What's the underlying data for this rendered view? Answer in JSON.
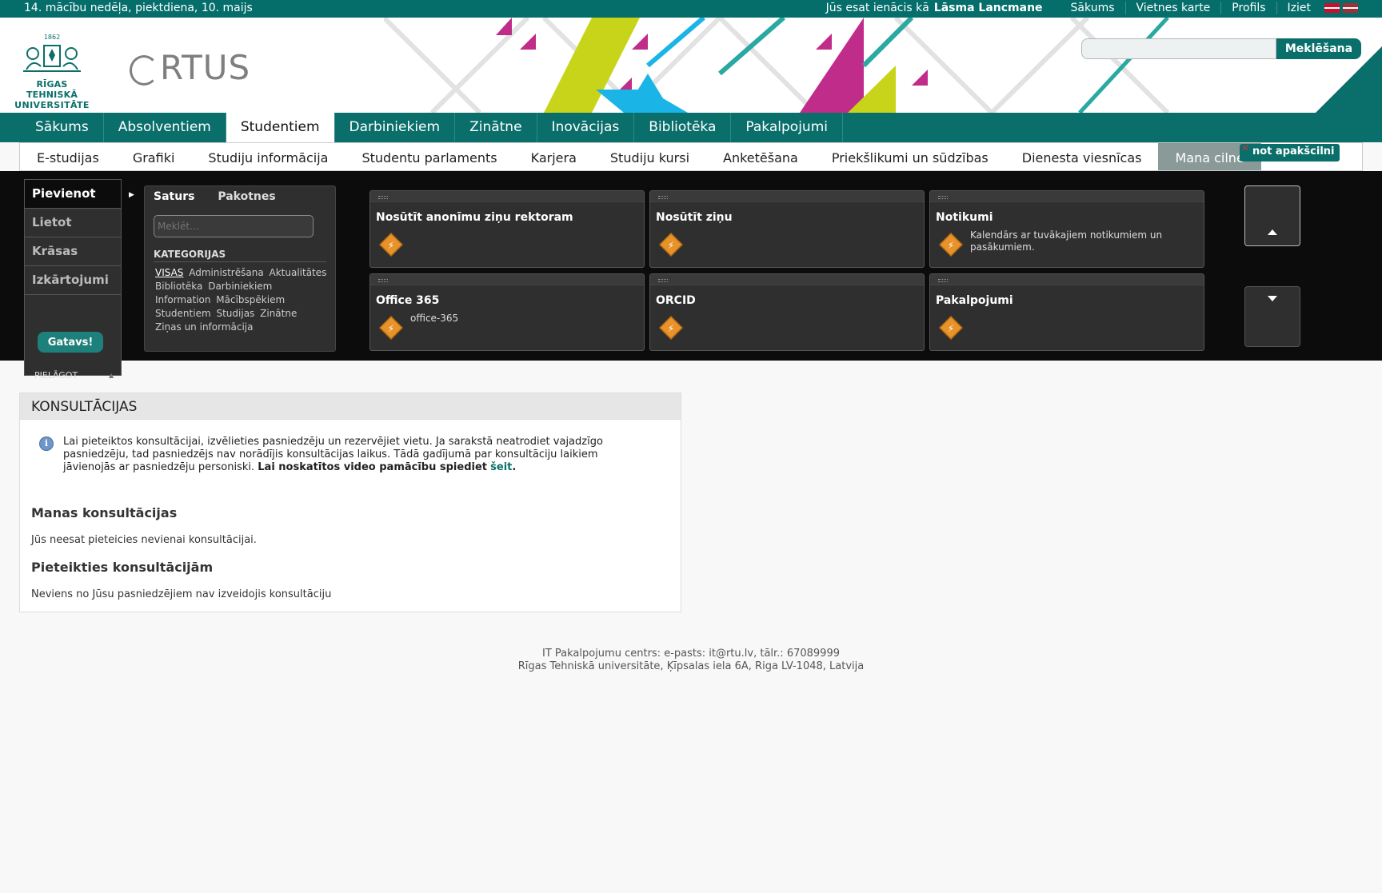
{
  "topbar": {
    "week": "14. mācību nedēļa, piektdiena, 10. maijs",
    "logged_in_as": "Jūs esat ienācis kā",
    "user_name": "Lāsma Lancmane",
    "links": [
      "Sākums",
      "Vietnes karte",
      "Profils",
      "Iziet"
    ]
  },
  "header": {
    "logo_year": "1862",
    "logo_line1": "RĪGAS TEHNISKĀ",
    "logo_line2": "UNIVERSITĀTE",
    "ortus": "RTUS",
    "search_button": "Meklēšana",
    "search_value": ""
  },
  "mainnav": [
    "Sākums",
    "Absolventiem",
    "Studentiem",
    "Darbiniekiem",
    "Zinātne",
    "Inovācijas",
    "Bibliotēka",
    "Pakalpojumi"
  ],
  "subnav": [
    "E-studijas",
    "Grafiki",
    "Studiju informācija",
    "Studentu parlaments",
    "Karjera",
    "Studiju kursi",
    "Anketēšana",
    "Priekšlikumi un sūdzības",
    "Dienesta viesnīcas",
    "Mana cilne"
  ],
  "pin_button": "not apakšcilni",
  "customize": {
    "menu": [
      "Pievienot",
      "Lietot",
      "Krāsas",
      "Izkārtojumi"
    ],
    "done_button": "Gatavs!",
    "pielagot": "PIELĀGOT",
    "tabs": [
      "Saturs",
      "Pakotnes"
    ],
    "search_placeholder": "Meklēt...",
    "categories_title": "KATEGORIJAS",
    "categories": [
      "VISAS",
      "Administrēšana",
      "Aktualitātes",
      "Bibliotēka",
      "Darbiniekiem",
      "Information",
      "Mācībspēkiem",
      "Studentiem",
      "Studijas",
      "Zinātne",
      "Ziņas un informācija"
    ],
    "tiles": [
      {
        "title": "Nosūtīt anonīmu ziņu rektoram",
        "desc": ""
      },
      {
        "title": "Nosūtīt ziņu",
        "desc": ""
      },
      {
        "title": "Notikumi",
        "desc": "Kalendārs ar tuvākajiem notikumiem un pasākumiem."
      },
      {
        "title": "Office 365",
        "desc": "office-365"
      },
      {
        "title": "ORCID",
        "desc": ""
      },
      {
        "title": "Pakalpojumi",
        "desc": ""
      }
    ]
  },
  "panel": {
    "title": "KONSULTĀCIJAS",
    "info_text": "Lai pieteiktos konsultācijai, izvēlieties pasniedzēju un rezervējiet vietu. Ja sarakstā neatrodiet vajadzīgo pasniedzēju, tad pasniedzējs nav norādījis konsultācijas laikus. Tādā gadījumā par konsultāciju laikiem jāvienojās ar pasniedzēju personiski.",
    "info_bold": "Lai noskatītos video pamācību spiediet",
    "info_link": "šeit",
    "my_title": "Manas konsultācijas",
    "my_text": "Jūs neesat pieteicies nevienai konsultācijai.",
    "apply_title": "Pieteikties konsultācijām",
    "apply_text": "Neviens no Jūsu pasniedzējiem nav izveidojis konsultāciju"
  },
  "footer": {
    "line1": "IT Pakalpojumu centrs: e-pasts: it@rtu.lv, tālr.: 67089999",
    "line2": "Rīgas Tehniskā universitāte, Ķīpsalas iela 6A, Riga LV-1048, Latvija"
  },
  "colors": {
    "brand": "#0a6f6b",
    "topbar": "#056e6b",
    "tile_icon": "#e8922a"
  }
}
